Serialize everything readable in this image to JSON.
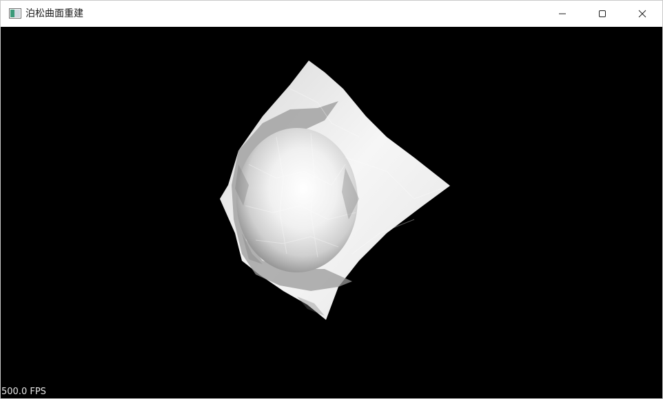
{
  "window": {
    "title": "泊松曲面重建",
    "app_icon": "opengl-app-icon",
    "controls": {
      "minimize_icon": "minimize-icon",
      "maximize_icon": "maximize-icon",
      "close_icon": "close-icon"
    }
  },
  "viewport": {
    "background": "#000000",
    "model": "poisson-reconstructed-surface",
    "mesh_color": "#ffffff",
    "fps_text": "500.0 FPS"
  }
}
